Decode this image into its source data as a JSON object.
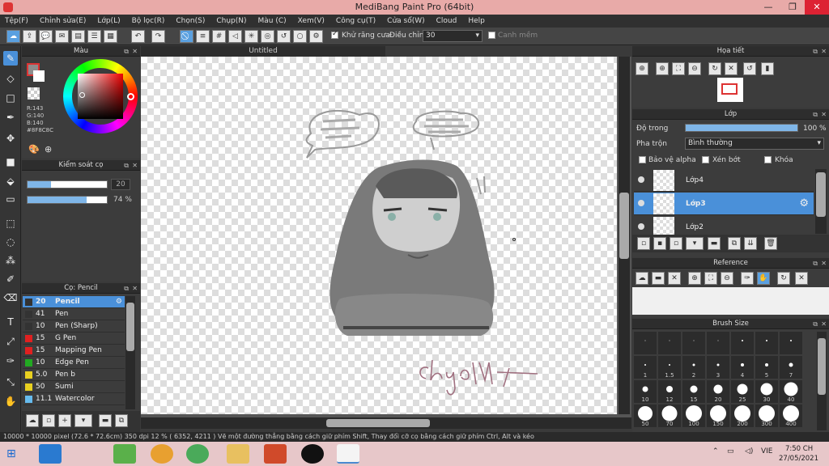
{
  "window": {
    "title": "MediBang Paint Pro (64bit)",
    "min": "—",
    "max": "❐",
    "close": "✕"
  },
  "menu": [
    "Tệp(F)",
    "Chỉnh sửa(E)",
    "Lớp(L)",
    "Bộ lọc(R)",
    "Chọn(S)",
    "Chụp(N)",
    "Màu (C)",
    "Xem(V)",
    "Công cụ(T)",
    "Cửa sổ(W)",
    "Cloud",
    "Help"
  ],
  "toolbar": {
    "antialias_label": "Khử răng cưa",
    "antialias_checked": true,
    "adjust_label": "Điều chỉnh",
    "adjust_value": "30",
    "smooth_label": "Canh mềm",
    "smooth_checked": false
  },
  "color_panel": {
    "title": "Màu",
    "primary_color": "#8F8C8C",
    "r": "R:143",
    "g": "G:140",
    "b": "B:140",
    "hex": "#8F8C8C"
  },
  "brush_control": {
    "title": "Kiểm soát cọ",
    "size": "20",
    "size_fraction": 0.3,
    "opacity": "74 %",
    "opacity_fraction": 0.74
  },
  "brush_list": {
    "title": "Cọ: Pencil",
    "items": [
      {
        "size": "20",
        "name": "Pencil",
        "color": "#333333",
        "selected": true
      },
      {
        "size": "41",
        "name": "Pen",
        "color": "#333333"
      },
      {
        "size": "10",
        "name": "Pen (Sharp)",
        "color": "#333333"
      },
      {
        "size": "15",
        "name": "G Pen",
        "color": "#e02020"
      },
      {
        "size": "15",
        "name": "Mapping Pen",
        "color": "#e02020"
      },
      {
        "size": "10",
        "name": "Edge Pen",
        "color": "#22aa22"
      },
      {
        "size": "5.0",
        "name": "Pen b",
        "color": "#e8d020"
      },
      {
        "size": "50",
        "name": "Sumi",
        "color": "#e8d020"
      },
      {
        "size": "11.1",
        "name": "Watercolor",
        "color": "#66bbee"
      }
    ]
  },
  "canvas": {
    "tab": "Untitled"
  },
  "status": {
    "text": "10000 * 10000 pixel   (72.6 * 72.6cm)   350 dpi   12 %   ( 6352, 4211 )   Vẽ một đường thẳng bằng cách giữ phím Shift, Thay đổi cỡ cọ bằng cách giữ phím Ctrl, Alt và kéo"
  },
  "navigator": {
    "title": "Họa tiết"
  },
  "layers": {
    "title": "Lớp",
    "opacity_label": "Độ trong",
    "opacity_value": "100 %",
    "opacity_fraction": 1.0,
    "blend_label": "Pha trộn",
    "blend_value": "Bình thường",
    "protect_alpha": "Bảo vệ alpha",
    "clipping": "Xén bớt",
    "lock": "Khóa",
    "items": [
      {
        "name": "Lớp4",
        "selected": false
      },
      {
        "name": "Lớp3",
        "selected": true
      },
      {
        "name": "Lớp2",
        "selected": false
      }
    ]
  },
  "reference": {
    "title": "Reference"
  },
  "brush_size": {
    "title": "Brush Size",
    "sizes": [
      "",
      "",
      "",
      "",
      "",
      "",
      "",
      "1",
      "1.5",
      "2",
      "3",
      "4",
      "5",
      "7",
      "10",
      "12",
      "15",
      "20",
      "25",
      "30",
      "40",
      "50",
      "70",
      "100",
      "150",
      "200",
      "300",
      "400"
    ]
  },
  "taskbar": {
    "lang": "VIE",
    "time": "7:50 CH",
    "date": "27/05/2021"
  }
}
